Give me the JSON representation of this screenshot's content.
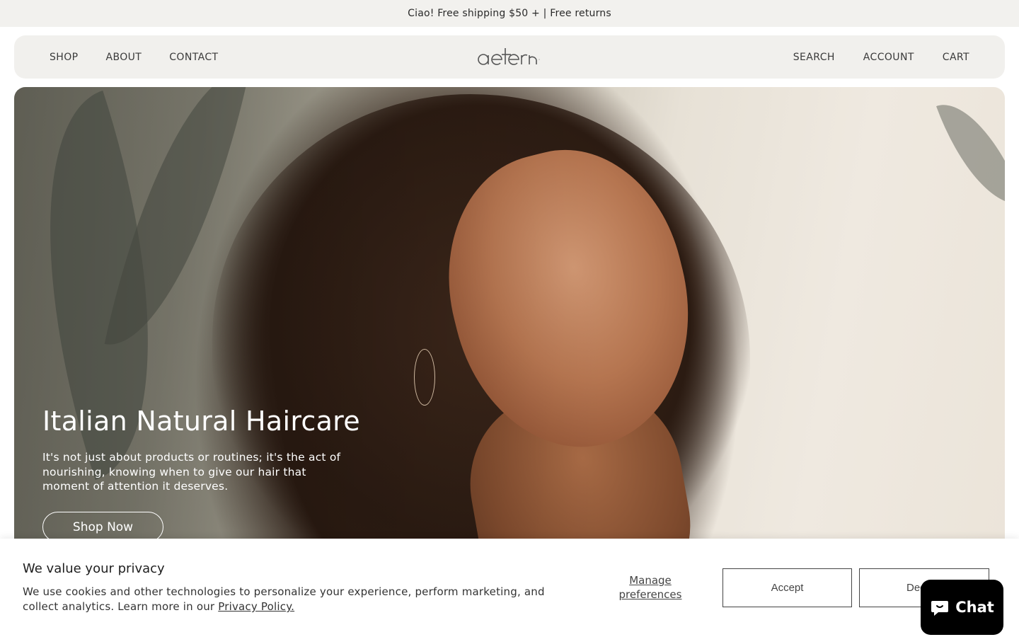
{
  "announcement": "Ciao! Free shipping $50 + | Free returns",
  "nav": {
    "left": [
      "SHOP",
      "ABOUT",
      "CONTACT"
    ],
    "right": [
      "SEARCH",
      "ACCOUNT",
      "CART"
    ],
    "logo_text": "aeterna"
  },
  "hero": {
    "title": "Italian Natural Haircare",
    "description": "It's not just about products or routines; it's the act of nourishing, knowing when to give our hair that moment of attention it deserves.",
    "button": "Shop Now"
  },
  "cookie": {
    "title": "We value your privacy",
    "text": "We use cookies and other technologies to personalize your experience, perform marketing, and collect analytics. Learn more in our ",
    "link": "Privacy Policy.",
    "manage": "Manage preferences",
    "accept": "Accept",
    "decline": "Decline"
  },
  "chat": {
    "label": "Chat",
    "icon": "chat-bubble-icon"
  },
  "colors": {
    "announce_bg": "#f2f1ee",
    "header_bg": "#f1f0ed",
    "chat_bg": "#000000"
  }
}
